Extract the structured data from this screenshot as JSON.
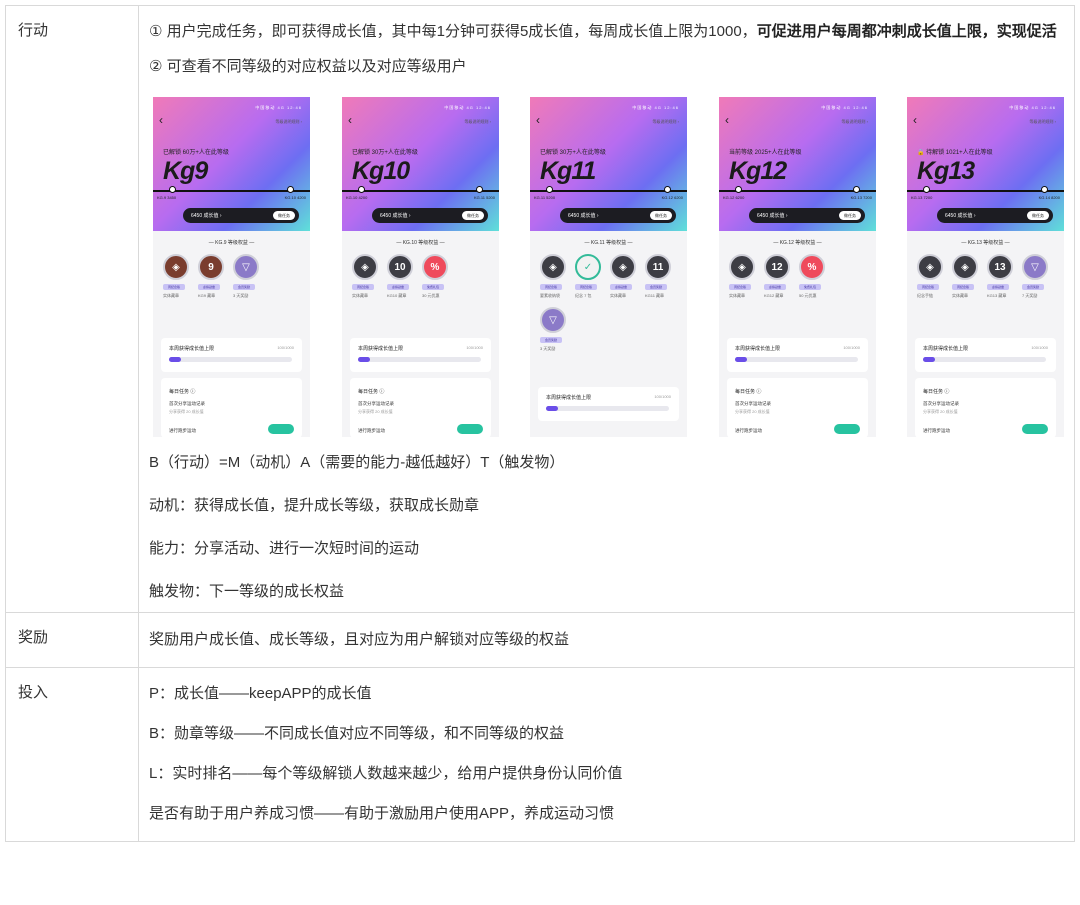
{
  "rows": [
    {
      "label": "行动",
      "paragraphs": [
        {
          "lead": "① 用户完成任务，即可获得成长值，其中每1分钟可获得5成长值，每周成长值上限为1000，",
          "bold": "可促进用户每周都冲刺成长值上限，实现促活"
        },
        {
          "text": "② 可查看不同等级的对应权益以及对应等级用户"
        }
      ],
      "after": [
        "B（行动）=M（动机）A（需要的能力-越低越好）T（触发物）",
        "动机：获得成长值，提升成长等级，获取成长勋章",
        "能力：分享活动、进行一次短时间的运动",
        "触发物：下一等级的成长权益"
      ]
    },
    {
      "label": "奖励",
      "text": "奖励用户成长值、成长等级，且对应为用户解锁对应等级的权益"
    },
    {
      "label": "投入",
      "paragraphs": [
        "P：成长值——keepAPP的成长值",
        "B：勋章等级——不同成长值对应不同等级，和不同等级的权益",
        "L：实时排名——每个等级解锁人数越来越少，给用户提供身份认同价值",
        "是否有助于用户养成习惯——有助于激励用户使用APP，养成运动习惯"
      ]
    }
  ],
  "screens": [
    {
      "state": "已解锁 60万+人在此等级",
      "level": "Kg9",
      "ticks_left": "KG.9\n3450",
      "ticks_right": "KG.10\n4200",
      "pill": "6450 成长值 ›",
      "btn": "做任务",
      "bene_title": "— KG.9 等级权益 —",
      "badges": [
        {
          "glyph": "◈",
          "style": "brown",
          "tag": "周纪念版",
          "desc": "实体藏章"
        },
        {
          "glyph": "9",
          "style": "brown",
          "tag": "虚拟勋章",
          "desc": "KG9 藏章"
        },
        {
          "glyph": "▽",
          "style": "purple",
          "tag": "会员奖励",
          "desc": "3 天奖励"
        }
      ],
      "week_title": "本周获得成长值上限",
      "week_num": "100/1000",
      "week_pct": 10,
      "task_title": "每日任务 ⓘ",
      "task_item": "首次分享运动记录",
      "task_sub": "分享获得 20 成长值",
      "task_more": "进行跑步运动"
    },
    {
      "state": "已解锁 30万+人在此等级",
      "level": "Kg10",
      "ticks_left": "KG.10\n4200",
      "ticks_right": "KG.11\n5200",
      "pill": "6450 成长值 ›",
      "btn": "做任务",
      "bene_title": "— KG.10 等级权益 —",
      "badges": [
        {
          "glyph": "◈",
          "style": "gray",
          "tag": "周纪念版",
          "desc": "实体藏章"
        },
        {
          "glyph": "10",
          "style": "gray",
          "tag": "虚拟勋章",
          "desc": "KG10 藏章"
        },
        {
          "glyph": "%",
          "style": "red",
          "tag": "免费礼包",
          "desc": "30 元优惠"
        }
      ],
      "week_title": "本周获得成长值上限",
      "week_num": "100/1000",
      "week_pct": 10,
      "task_title": "每日任务 ⓘ",
      "task_item": "首次分享运动记录",
      "task_sub": "分享获得 20 成长值",
      "task_more": "进行跑步运动"
    },
    {
      "state": "已解锁 30万+人在此等级",
      "level": "Kg11",
      "ticks_left": "KG.11\n5200",
      "ticks_right": "KG.12\n6200",
      "pill": "6450 成长值 ›",
      "btn": "做任务",
      "bene_title": "— KG.11 等级权益 —",
      "badges": [
        {
          "glyph": "◈",
          "style": "gray",
          "tag": "周纪念版",
          "desc": "要素收纳袋"
        },
        {
          "glyph": "✓",
          "style": "white",
          "tag": "周纪念版",
          "desc": "纪念 7 包"
        },
        {
          "glyph": "◈",
          "style": "gray",
          "tag": "虚拟勋章",
          "desc": "实体藏章"
        },
        {
          "glyph": "11",
          "style": "gray",
          "tag": "会员奖励",
          "desc": "KG11 藏章"
        }
      ],
      "extra_badge": {
        "glyph": "▽",
        "style": "purple",
        "tag": "会员奖励",
        "desc": "3 天奖励"
      },
      "week_title": "本周获得成长值上限",
      "week_num": "100/1000",
      "week_pct": 10
    },
    {
      "state": "当前等级 2025+人在此等级",
      "level": "Kg12",
      "ticks_left": "KG.12\n6200",
      "ticks_right": "KG.13\n7200",
      "pill": "6450 成长值 ›",
      "btn": "做任务",
      "bene_title": "— KG.12 等级权益 —",
      "badges": [
        {
          "glyph": "◈",
          "style": "gray",
          "tag": "周纪念版",
          "desc": "实体藏章"
        },
        {
          "glyph": "12",
          "style": "gray",
          "tag": "虚拟勋章",
          "desc": "KG12 藏章"
        },
        {
          "glyph": "%",
          "style": "red",
          "tag": "免费礼包",
          "desc": "50 元优惠"
        }
      ],
      "week_title": "本周获得成长值上限",
      "week_num": "100/1000",
      "week_pct": 10,
      "task_title": "每日任务 ⓘ",
      "task_item": "首次分享运动记录",
      "task_sub": "分享获得 20 成长值",
      "task_more": "进行跑步运动"
    },
    {
      "state": "🔒 待解锁 1021+人在此等级",
      "level": "Kg13",
      "ticks_left": "KG.13\n7200",
      "ticks_right": "KG.14\n8200",
      "pill": "6450 成长值 ›",
      "btn": "做任务",
      "bene_title": "— KG.13 等级权益 —",
      "badges": [
        {
          "glyph": "◈",
          "style": "gray",
          "tag": "周纪念版",
          "desc": "纪念手链"
        },
        {
          "glyph": "◈",
          "style": "gray",
          "tag": "周纪念版",
          "desc": "实体藏章"
        },
        {
          "glyph": "13",
          "style": "gray",
          "tag": "虚拟勋章",
          "desc": "KG13 藏章"
        },
        {
          "glyph": "▽",
          "style": "purple",
          "tag": "会员奖励",
          "desc": "7 天奖励"
        }
      ],
      "week_title": "本周获得成长值上限",
      "week_num": "100/1000",
      "week_pct": 10,
      "task_title": "每日任务 ⓘ",
      "task_item": "首次分享运动记录",
      "task_sub": "分享获得 20 成长值",
      "task_more": "进行跑步运动"
    }
  ],
  "common": {
    "status": "中国移动 4G 12:46",
    "rule": "等级说明规则 ›",
    "back": "‹"
  }
}
